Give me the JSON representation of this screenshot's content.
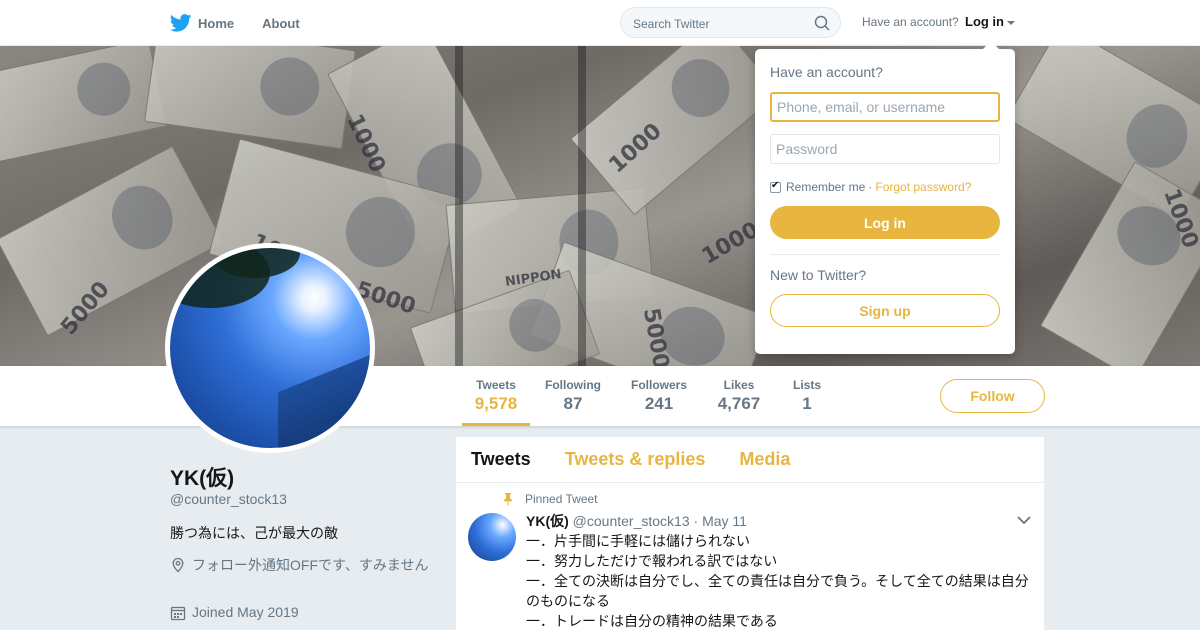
{
  "nav": {
    "home_label": "Home",
    "about_label": "About",
    "search_placeholder": "Search Twitter",
    "have_account": "Have an account?",
    "login_label": "Log in"
  },
  "banner": {
    "note_labels": [
      "1000",
      "5000",
      "1000",
      "NIPPON",
      "5000",
      "1000",
      "1000",
      "1000",
      "5000"
    ]
  },
  "profile_nav": {
    "stats": [
      {
        "label": "Tweets",
        "value": "9,578"
      },
      {
        "label": "Following",
        "value": "87"
      },
      {
        "label": "Followers",
        "value": "241"
      },
      {
        "label": "Likes",
        "value": "4,767"
      },
      {
        "label": "Lists",
        "value": "1"
      }
    ],
    "follow_label": "Follow"
  },
  "profile": {
    "name": "YK(仮)",
    "handle": "@counter_stock13",
    "bio": "勝つ為には、己が最大の敵",
    "location": "フォロー外通知OFFです、すみません",
    "joined": "Joined May 2019"
  },
  "timeline": {
    "tabs": [
      "Tweets",
      "Tweets & replies",
      "Media"
    ],
    "pinned_label": "Pinned Tweet",
    "tweet": {
      "name": "YK(仮)",
      "handle": "@counter_stock13",
      "date": "· May 11",
      "lines": [
        "一．片手間に手軽には儲けられない",
        "一．努力しただけで報われる訳ではない",
        "一．全ての決断は自分でし、全ての責任は自分で負う。そして全ての結果は自分のものになる",
        "一．トレードは自分の精神の結果である"
      ]
    }
  },
  "login_dropdown": {
    "title": "Have an account?",
    "username_placeholder": "Phone, email, or username",
    "password_placeholder": "Password",
    "remember_label": "Remember me",
    "separator": "·",
    "forgot_label": "Forgot password?",
    "login_button": "Log in",
    "new_label": "New to Twitter?",
    "signup_button": "Sign up"
  },
  "colors": {
    "accent": "#e8b53f",
    "text_secondary": "#657786",
    "background": "#e6ecf0"
  }
}
